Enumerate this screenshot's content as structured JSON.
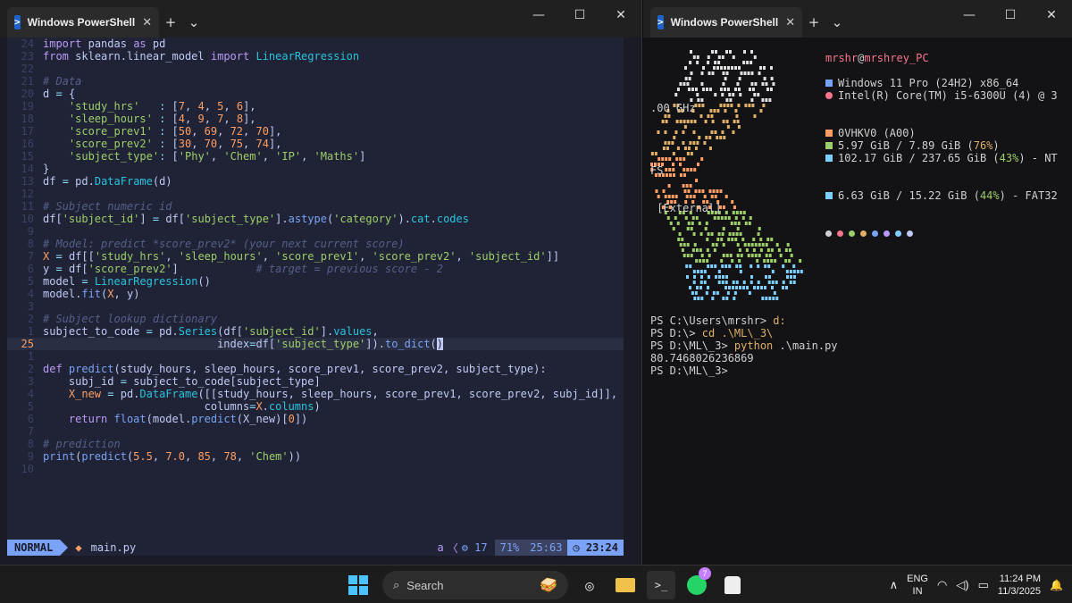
{
  "left_window": {
    "tab_title": "Windows PowerShell",
    "new_tab": "+",
    "dropdown": "⌄",
    "minimize": "—",
    "maximize": "☐",
    "close": "✕",
    "tab_close": "✕"
  },
  "right_window": {
    "tab_title": "Windows PowerShell",
    "new_tab": "+",
    "dropdown": "⌄",
    "minimize": "—",
    "maximize": "☐",
    "close": "✕",
    "tab_close": "✕"
  },
  "editor": {
    "lines": [
      {
        "n": "24",
        "html": "<span class='k'>import</span> <span class='v'>pandas</span> <span class='k'>as</span> <span class='v'>pd</span>"
      },
      {
        "n": "23",
        "html": "<span class='k'>from</span> <span class='v'>sklearn.linear_model</span> <span class='k'>import</span> <span class='cls'>LinearRegression</span>"
      },
      {
        "n": "22",
        "html": ""
      },
      {
        "n": "21",
        "html": "<span class='c'># Data</span>"
      },
      {
        "n": "20",
        "html": "<span class='v'>d</span> <span class='p'>=</span> <span class='v'>{</span>"
      },
      {
        "n": "19",
        "html": "    <span class='s'>'study_hrs'</span>   <span class='p'>:</span> <span class='v'>[</span><span class='n'>7</span>, <span class='n'>4</span>, <span class='n'>5</span>, <span class='n'>6</span><span class='v'>],</span>"
      },
      {
        "n": "18",
        "html": "    <span class='s'>'sleep_hours'</span> <span class='p'>:</span> <span class='v'>[</span><span class='n'>4</span>, <span class='n'>9</span>, <span class='n'>7</span>, <span class='n'>8</span><span class='v'>],</span>"
      },
      {
        "n": "17",
        "html": "    <span class='s'>'score_prev1'</span> <span class='p'>:</span> <span class='v'>[</span><span class='n'>50</span>, <span class='n'>69</span>, <span class='n'>72</span>, <span class='n'>70</span><span class='v'>],</span>"
      },
      {
        "n": "16",
        "html": "    <span class='s'>'score_prev2'</span> <span class='p'>:</span> <span class='v'>[</span><span class='n'>30</span>, <span class='n'>70</span>, <span class='n'>75</span>, <span class='n'>74</span><span class='v'>],</span>"
      },
      {
        "n": "15",
        "html": "    <span class='s'>'subject_type'</span><span class='p'>:</span> <span class='v'>[</span><span class='s'>'Phy'</span>, <span class='s'>'Chem'</span>, <span class='s'>'IP'</span>, <span class='s'>'Maths'</span><span class='v'>]</span>"
      },
      {
        "n": "14",
        "html": "<span class='v'>}</span>"
      },
      {
        "n": "13",
        "html": "<span class='v'>df</span> <span class='p'>=</span> <span class='v'>pd.</span><span class='cls'>DataFrame</span><span class='v'>(d)</span>"
      },
      {
        "n": "12",
        "html": ""
      },
      {
        "n": "11",
        "html": "<span class='c'># Subject numeric id</span>"
      },
      {
        "n": "10",
        "html": "<span class='v'>df[</span><span class='s'>'subject_id'</span><span class='v'>]</span> <span class='p'>=</span> <span class='v'>df[</span><span class='s'>'subject_type'</span><span class='v'>].</span><span class='f'>astype</span><span class='v'>(</span><span class='s'>'category'</span><span class='v'>).</span><span class='cls'>cat</span><span class='v'>.</span><span class='cls'>codes</span>"
      },
      {
        "n": "9",
        "html": ""
      },
      {
        "n": "8",
        "html": "<span class='c'># Model: predict *score_prev2* (your next current score)</span>"
      },
      {
        "n": "7",
        "html": "<span class='n'>X</span> <span class='p'>=</span> <span class='v'>df[[</span><span class='s'>'study_hrs'</span>, <span class='s'>'sleep_hours'</span>, <span class='s'>'score_prev1'</span>, <span class='s'>'score_prev2'</span>, <span class='s'>'subject_id'</span><span class='v'>]]</span>"
      },
      {
        "n": "6",
        "html": "<span class='v'>y</span> <span class='p'>=</span> <span class='v'>df[</span><span class='s'>'score_prev2'</span><span class='v'>]</span>            <span class='c'># target = previous score - 2</span>"
      },
      {
        "n": "5",
        "html": "<span class='v'>model</span> <span class='p'>=</span> <span class='cls'>LinearRegression</span><span class='v'>()</span>"
      },
      {
        "n": "4",
        "html": "<span class='v'>model.</span><span class='f'>fit</span><span class='v'>(</span><span class='n'>X</span><span class='v'>, y)</span>"
      },
      {
        "n": "3",
        "html": ""
      },
      {
        "n": "2",
        "html": "<span class='c'># Subject lookup dictionary</span>"
      },
      {
        "n": "1",
        "html": "<span class='v'>subject_to_code</span> <span class='p'>=</span> <span class='v'>pd.</span><span class='cls'>Series</span><span class='v'>(df[</span><span class='s'>'subject_id'</span><span class='v'>].</span><span class='cls'>values</span><span class='v'>,</span>"
      },
      {
        "n": "25",
        "cur": true,
        "html": "                           <span class='v'>index</span><span class='p'>=</span><span class='v'>df[</span><span class='s'>'subject_type'</span><span class='v'>]).</span><span class='f'>to_dict</span><span class='v'>(</span><span class='cursor'>)</span>"
      },
      {
        "n": "1",
        "html": ""
      },
      {
        "n": "2",
        "html": "<span class='k'>def</span> <span class='f'>predict</span><span class='v'>(study_hours, sleep_hours, score_prev1, score_prev2, subject_type):</span>"
      },
      {
        "n": "3",
        "html": "    <span class='v'>subj_id</span> <span class='p'>=</span> <span class='v'>subject_to_code[subject_type]</span>"
      },
      {
        "n": "4",
        "html": "    <span class='n'>X_new</span> <span class='p'>=</span> <span class='v'>pd.</span><span class='cls'>DataFrame</span><span class='v'>([[study_hours, sleep_hours, score_prev1, score_prev2, subj_id]],</span>"
      },
      {
        "n": "5",
        "html": "                         <span class='v'>columns</span><span class='p'>=</span><span class='n'>X</span><span class='v'>.</span><span class='cls'>columns</span><span class='v'>)</span>"
      },
      {
        "n": "6",
        "html": "    <span class='k'>return</span> <span class='f'>float</span><span class='v'>(model.</span><span class='f'>predict</span><span class='v'>(X_new)[</span><span class='n'>0</span><span class='v'>])</span>"
      },
      {
        "n": "7",
        "html": ""
      },
      {
        "n": "8",
        "html": "<span class='c'># prediction</span>"
      },
      {
        "n": "9",
        "html": "<span class='f'>print</span><span class='v'>(</span><span class='f'>predict</span><span class='v'>(</span><span class='n'>5.5</span>, <span class='n'>7.0</span>, <span class='n'>85</span>, <span class='n'>78</span>, <span class='s'>'Chem'</span><span class='v'>))</span>"
      },
      {
        "n": "10",
        "html": ""
      }
    ]
  },
  "statusline": {
    "mode": "NORMAL",
    "diamond": "◆",
    "filename": "main.py",
    "a": "a",
    "chevron": "〈",
    "gear": "⚙ 17",
    "percent": "71%",
    "position": "25:63",
    "clock": "◷ 23:24"
  },
  "fastfetch": {
    "user": "mrshr",
    "at": "@",
    "host": "mrshrey_PC",
    "os": "Windows 11 Pro (24H2) x86_64",
    "cpu": "Intel(R) Core(TM) i5-6300U (4) @ 3",
    "cpu_wrap": ".00 GHz",
    "board": "0VHKV0 (A00)",
    "mem_a": "5.97 GiB / 7.89 GiB (",
    "mem_pct": "76%",
    "mem_b": ")",
    "disk1_a": "102.17 GiB / 237.65 GiB (",
    "disk1_pct": "43%",
    "disk1_b": ") - NT",
    "disk1_wrap": "FS",
    "disk2_a": "6.63 GiB / 15.22 GiB (",
    "disk2_pct": "44%",
    "disk2_b": ") - FAT32",
    "disk2_wrap": " [External]",
    "palette": [
      "#d0d0d0",
      "#f7768e",
      "#9ece6a",
      "#e0af68",
      "#7aa2f7",
      "#bb9af7",
      "#7dcfff",
      "#c0caf5"
    ]
  },
  "shell": {
    "l1_prompt": "PS C:\\Users\\mrshr> ",
    "l1_cmd": "d:",
    "l2_prompt": "PS D:\\> ",
    "l2_cmd": "cd .\\ML\\_3\\",
    "l3_prompt": "PS D:\\ML\\_3> ",
    "l3_cmd": "python",
    "l3_arg": " .\\main.py",
    "l4": "80.7468026236869",
    "l5": "PS D:\\ML\\_3>"
  },
  "taskbar": {
    "search_placeholder": "Search",
    "whatsapp_badge": "7",
    "lang_top": "ENG",
    "lang_bottom": "IN",
    "time": "11:24 PM",
    "date": "11/3/2025"
  }
}
